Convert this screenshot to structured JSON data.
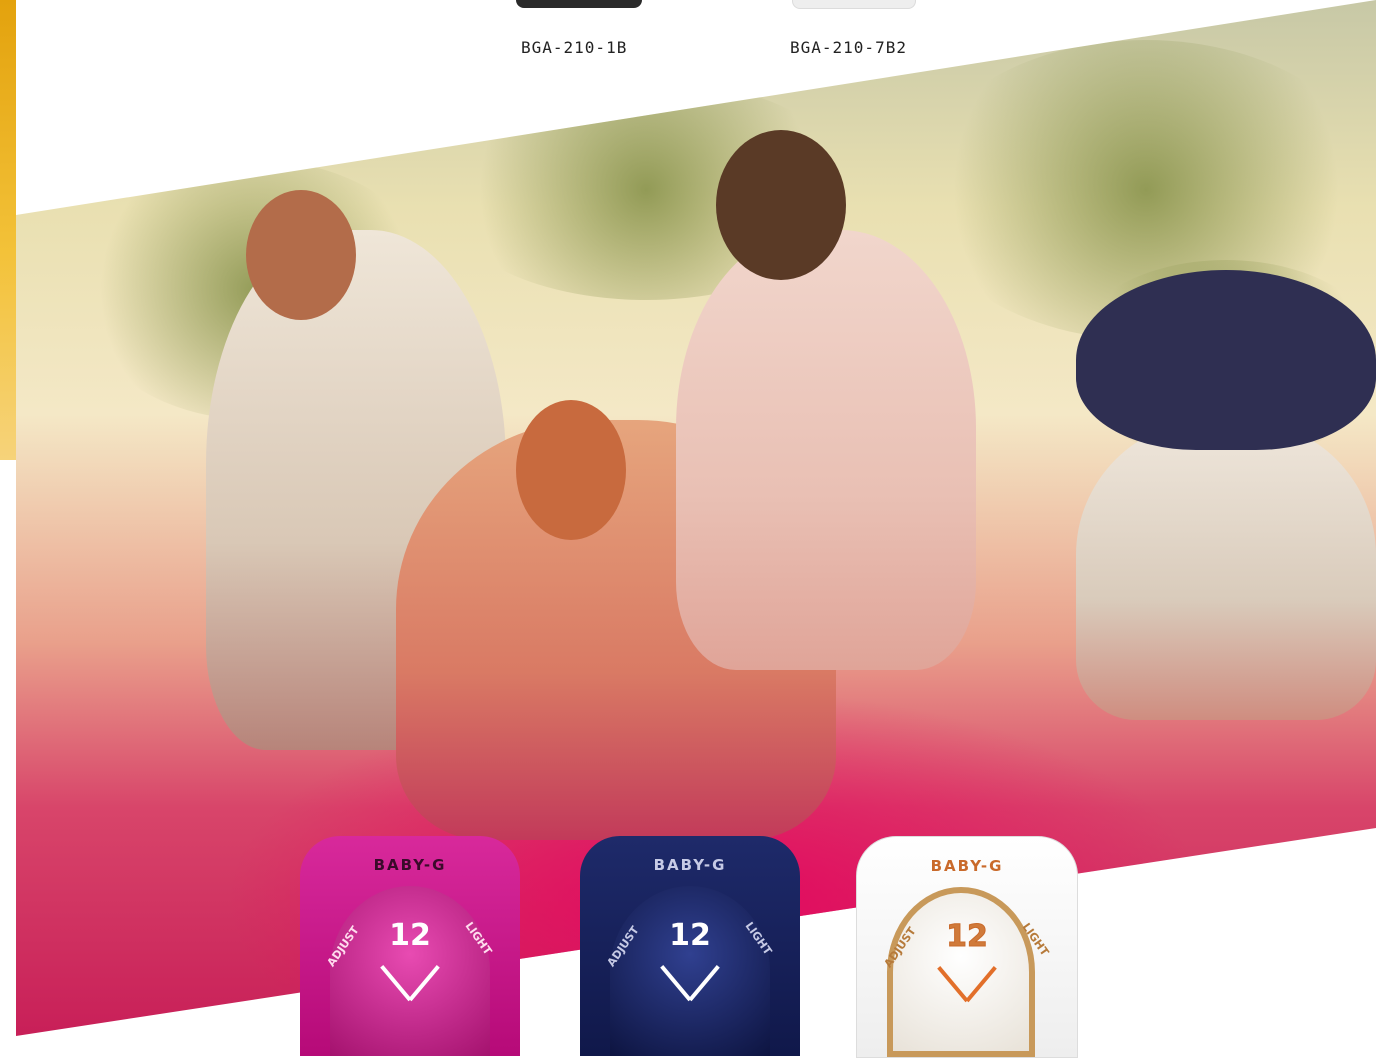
{
  "top_products": [
    {
      "model": "BGA-210-1B"
    },
    {
      "model": "BGA-210-7B2"
    }
  ],
  "hero_watches": [
    {
      "brand": "BABY-G",
      "dial_number": "12",
      "bezel_left": "ADJUST",
      "bezel_right": "LIGHT",
      "color": "#d11f93"
    },
    {
      "brand": "BABY-G",
      "dial_number": "12",
      "bezel_left": "ADJUST",
      "bezel_right": "LIGHT",
      "color": "#1a2560"
    },
    {
      "brand": "BABY-G",
      "dial_number": "12",
      "bezel_left": "ADJUST",
      "bezel_right": "LIGHT",
      "color": "#ffffff"
    }
  ],
  "colors": {
    "accent_yellow": "#e3a20d",
    "accent_pink": "#e7005f"
  }
}
